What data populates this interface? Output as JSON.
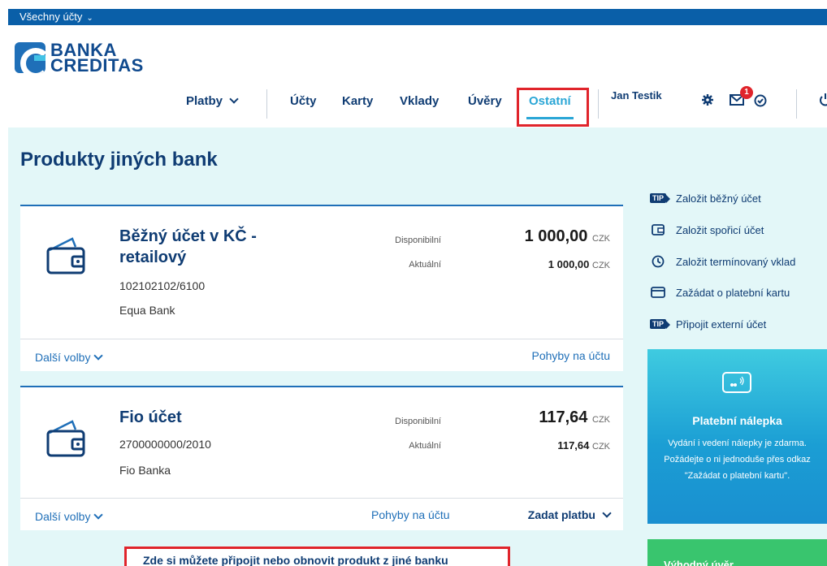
{
  "topbar": {
    "account_selector": "Všechny účty"
  },
  "brand": {
    "line1": "BANKA",
    "line2": "CREDITAS"
  },
  "nav": {
    "items": [
      "Platby",
      "Účty",
      "Karty",
      "Vklady",
      "Úvěry",
      "Ostatní"
    ],
    "active": "Ostatní",
    "user": "Jan Testik",
    "notifications": "1"
  },
  "page": {
    "title": "Produkty jiných bank"
  },
  "accounts": [
    {
      "name": "Běžný účet v KČ - retailový",
      "number": "102102102/6100",
      "bank": "Equa Bank",
      "available_label": "Disponibilní",
      "current_label": "Aktuální",
      "available": "1 000,00",
      "current": "1 000,00",
      "currency": "CZK",
      "more_label": "Další volby",
      "movements_label": "Pohyby na účtu"
    },
    {
      "name": "Fio účet",
      "number": "2700000000/2010",
      "bank": "Fio Banka",
      "available_label": "Disponibilní",
      "current_label": "Aktuální",
      "available": "117,64",
      "current": "117,64",
      "currency": "CZK",
      "more_label": "Další volby",
      "movements_label": "Pohyby na účtu",
      "pay_label": "Zadat platbu"
    }
  ],
  "sidebar": {
    "links": [
      {
        "icon": "tip-icon",
        "label": "Založit běžný účet"
      },
      {
        "icon": "wallet-icon",
        "label": "Založit spořicí účet"
      },
      {
        "icon": "clock-icon",
        "label": "Založit termínovaný vklad"
      },
      {
        "icon": "card-icon",
        "label": "Zažádat o platební kartu"
      },
      {
        "icon": "tip-icon",
        "label": "Připojit externí účet"
      }
    ],
    "promo": {
      "title": "Platební nálepka",
      "text": "Vydání i vedení nálepky je zdarma. Požádejte o ni jednoduše přes odkaz \"Zažádat o platební kartu\"."
    },
    "promo2": {
      "title": "Výhodný úvěr"
    }
  },
  "bottom_note": "Zde si můžete připojit nebo obnovit produkt z jiné banku",
  "colors": {
    "brand": "#0f3c73",
    "accent": "#2aa6d6",
    "highlight": "#e0242b"
  }
}
